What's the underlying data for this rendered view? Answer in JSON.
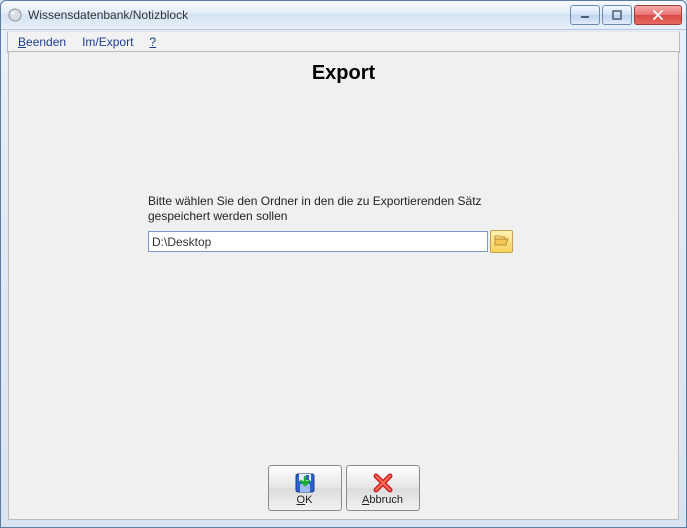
{
  "window": {
    "title": "Wissensdatenbank/Notizblock"
  },
  "menu": {
    "items": [
      {
        "label": "Beenden"
      },
      {
        "label": "Im/Export"
      },
      {
        "label": "?"
      }
    ]
  },
  "main": {
    "heading": "Export",
    "instruction": "Bitte wählen Sie den Ordner in den die zu Exportierenden Sätz gespeichert werden sollen",
    "path_value": "D:\\Desktop"
  },
  "buttons": {
    "ok": "OK",
    "cancel": "Abbruch"
  },
  "icons": {
    "app": "app-icon",
    "minimize": "minimize-icon",
    "maximize": "maximize-icon",
    "close": "close-icon",
    "folder": "folder-open-icon",
    "save": "save-disk-icon",
    "cancel": "cancel-x-icon"
  }
}
